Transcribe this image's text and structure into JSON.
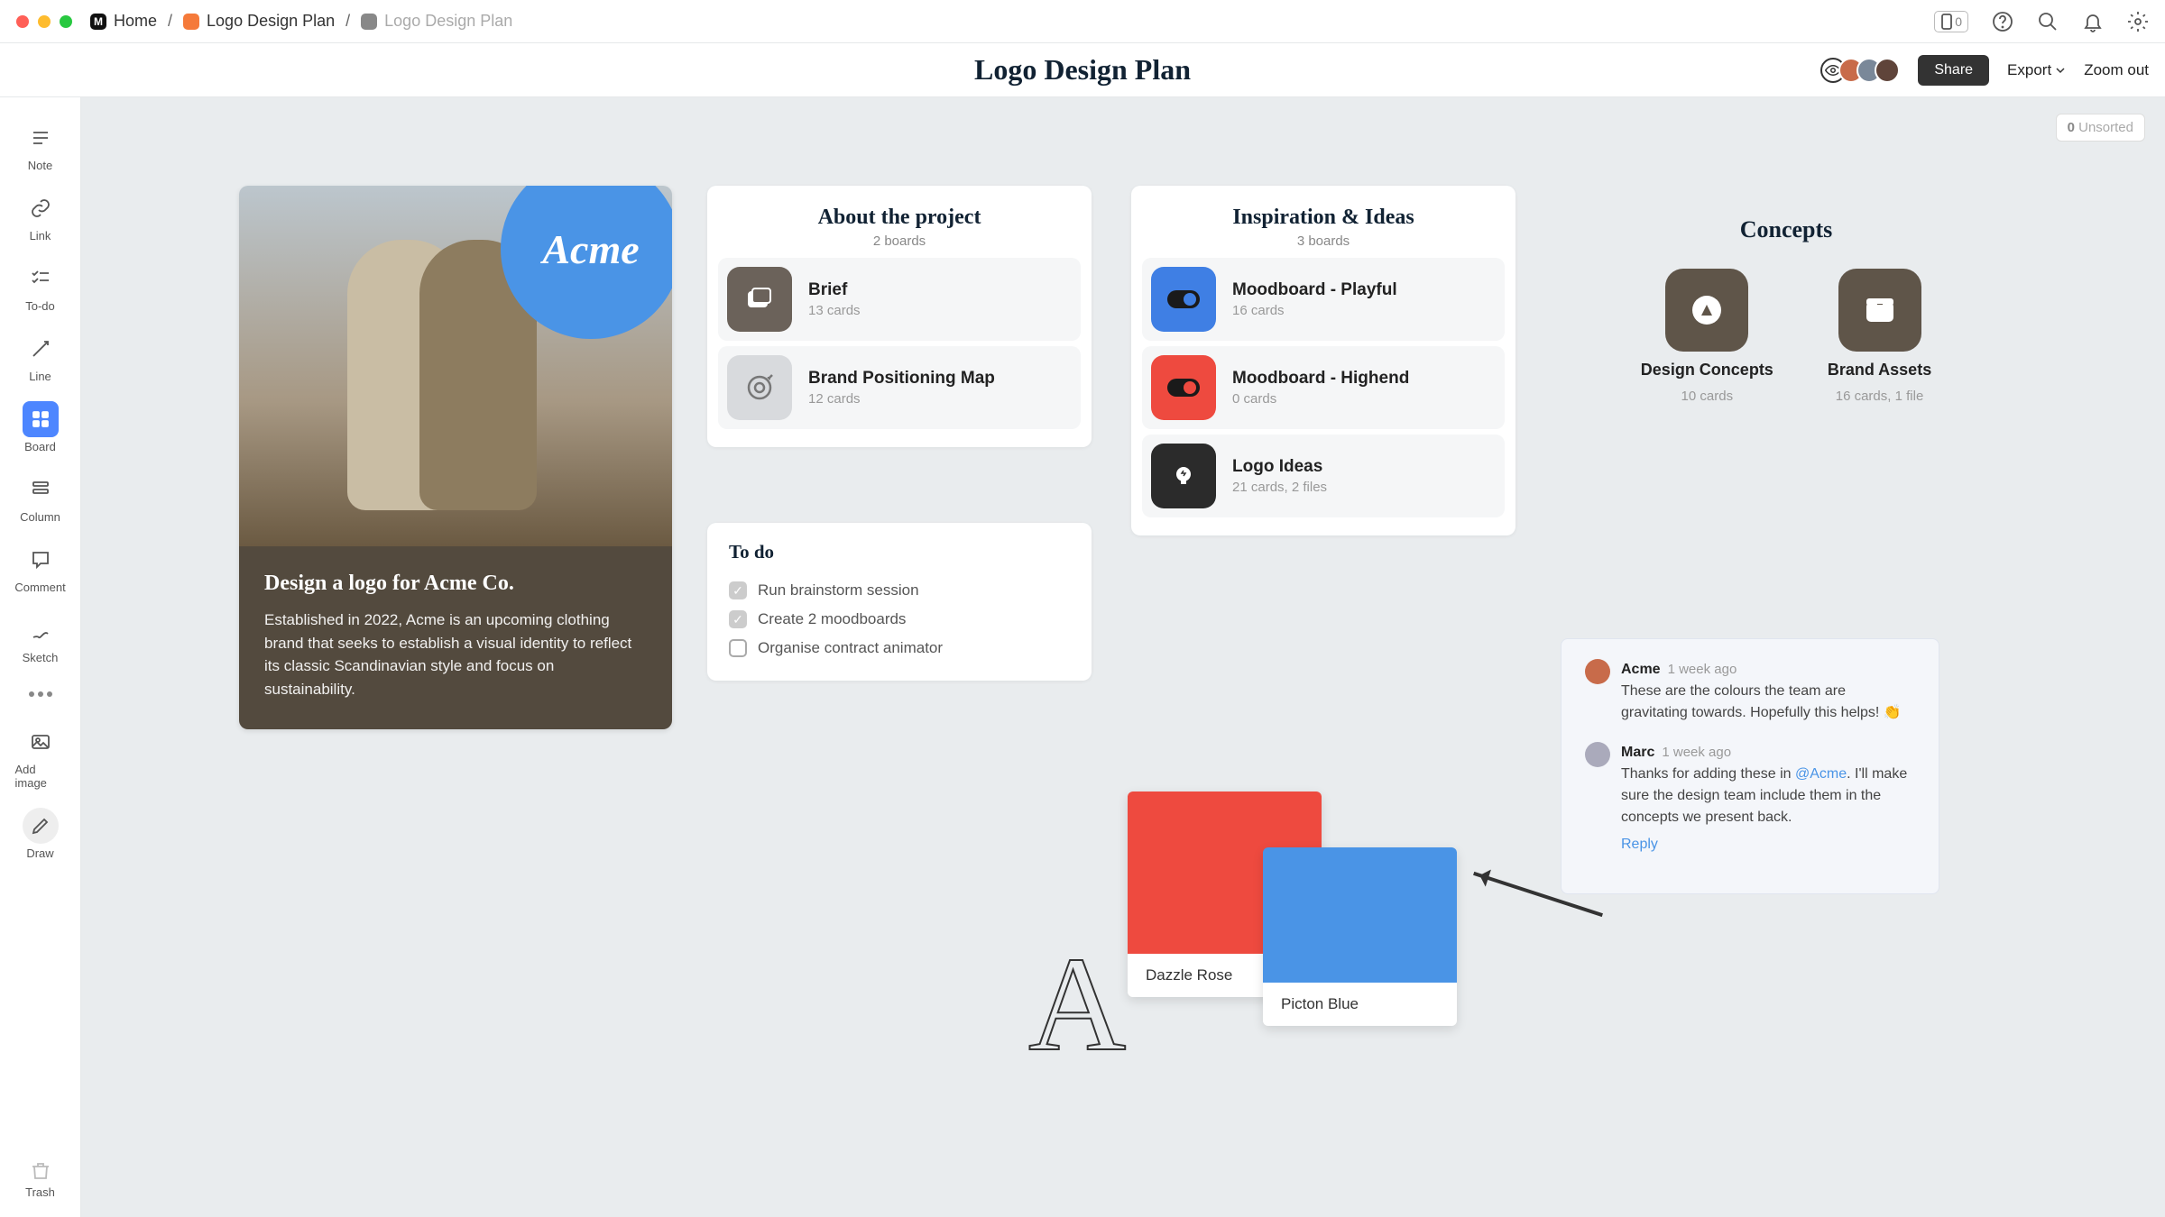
{
  "topbar": {
    "home": "Home",
    "crumb1": "Logo Design Plan",
    "crumb2": "Logo Design Plan",
    "phone_count": "0"
  },
  "header": {
    "title": "Logo Design Plan",
    "share": "Share",
    "export": "Export",
    "zoom": "Zoom out"
  },
  "tools": {
    "note": "Note",
    "link": "Link",
    "todo": "To-do",
    "line": "Line",
    "board": "Board",
    "column": "Column",
    "comment": "Comment",
    "sketch": "Sketch",
    "add_image": "Add image",
    "draw": "Draw",
    "trash": "Trash"
  },
  "unsorted": {
    "count": "0",
    "label": "Unsorted"
  },
  "brief": {
    "circle": "Acme",
    "title": "Design a logo for Acme Co.",
    "text": "Established in 2022, Acme is an upcoming clothing brand that seeks to establish a visual identity to reflect its classic Scandinavian style and focus on sustainability."
  },
  "about": {
    "title": "About the project",
    "subtitle": "2 boards",
    "items": [
      {
        "name": "Brief",
        "meta": "13 cards",
        "color": "#6b625a"
      },
      {
        "name": "Brand Positioning Map",
        "meta": "12 cards",
        "color": "#d8dadd"
      }
    ]
  },
  "todo": {
    "title": "To do",
    "items": [
      {
        "label": "Run brainstorm session",
        "done": true
      },
      {
        "label": "Create 2 moodboards",
        "done": true
      },
      {
        "label": "Organise contract animator",
        "done": false
      }
    ]
  },
  "inspiration": {
    "title": "Inspiration & Ideas",
    "subtitle": "3 boards",
    "items": [
      {
        "name": "Moodboard - Playful",
        "meta": "16 cards",
        "color": "#3f7fe4"
      },
      {
        "name": "Moodboard - Highend",
        "meta": "0 cards",
        "color": "#ee4a3f"
      },
      {
        "name": "Logo Ideas",
        "meta": "21 cards, 2 files",
        "color": "#2b2b2b"
      }
    ]
  },
  "concepts": {
    "title": "Concepts",
    "items": [
      {
        "name": "Design Concepts",
        "meta": "10 cards"
      },
      {
        "name": "Brand Assets",
        "meta": "16 cards, 1 file"
      }
    ]
  },
  "swatches": {
    "red": "Dazzle Rose",
    "blue": "Picton Blue"
  },
  "comments": [
    {
      "author": "Acme",
      "time": "1 week ago",
      "body": "These are the colours the team are gravitating towards. Hopefully this helps! 👏",
      "avatar": "#c86b4a"
    },
    {
      "author": "Marc",
      "time": "1 week ago",
      "body_pre": "Thanks for adding these in ",
      "mention": "@Acme",
      "body_post": ". I'll make sure the design team include them in the concepts we present back.",
      "avatar": "#888",
      "reply": "Reply"
    }
  ]
}
